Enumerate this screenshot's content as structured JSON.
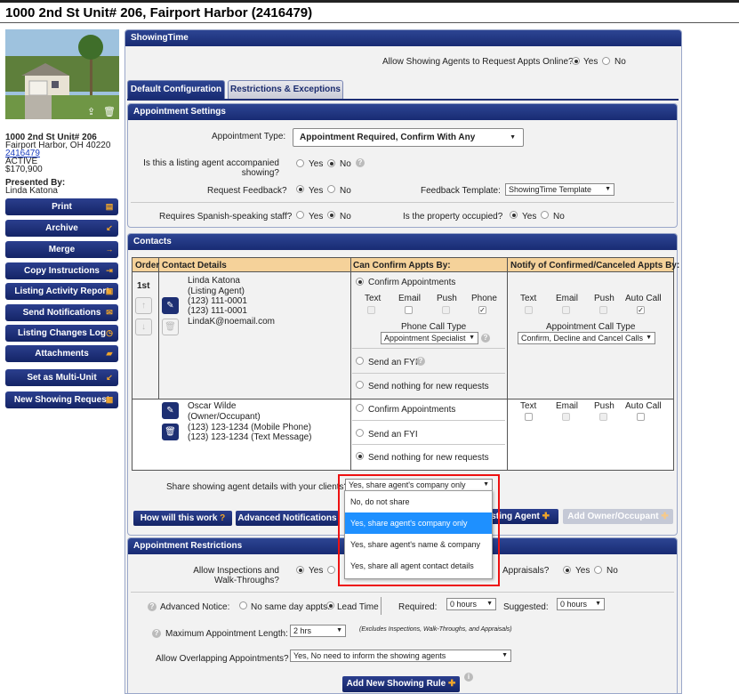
{
  "page_title": "1000 2nd St Unit# 206, Fairport Harbor (2416479)",
  "listing": {
    "address": "1000 2nd St Unit# 206",
    "city": "Fairport Harbor, OH 40220",
    "mls": "2416479",
    "status": "ACTIVE",
    "price": "$170,900",
    "presented_label": "Presented By:",
    "agent": "Linda Katona"
  },
  "sidebar_buttons": [
    {
      "label": "Print",
      "icon": "print-icon"
    },
    {
      "label": "Archive",
      "icon": "archive-icon"
    },
    {
      "label": "Merge",
      "icon": "merge-icon"
    },
    {
      "label": "Copy Instructions",
      "icon": "copy-icon"
    },
    {
      "label": "Listing Activity Report",
      "icon": "report-icon"
    },
    {
      "label": "Send Notifications",
      "icon": "envelope-icon"
    },
    {
      "label": "Listing Changes Log",
      "icon": "clock-icon"
    },
    {
      "label": "Attachments",
      "icon": "folder-icon"
    },
    {
      "label": "Set as Multi-Unit",
      "icon": "multiunit-icon"
    },
    {
      "label": "New Showing Request",
      "icon": "calendar-icon"
    }
  ],
  "showingtime": {
    "header": "ShowingTime",
    "allow_label": "Allow Showing Agents to Request Appts Online?",
    "yes": "Yes",
    "no": "No"
  },
  "tabs": {
    "default": "Default Configuration",
    "restrictions": "Restrictions & Exceptions"
  },
  "appt_settings": {
    "header": "Appointment Settings",
    "type_label": "Appointment Type:",
    "type_value": "Appointment Required, Confirm With Any",
    "accompanied_label1": "Is this a listing agent accompanied",
    "accompanied_label2": "showing?",
    "feedback_label": "Request Feedback?",
    "feedback_template_label": "Feedback Template:",
    "feedback_template_value": "ShowingTime Template",
    "spanish_label": "Requires Spanish-speaking staff?",
    "occupied_label": "Is the property occupied?",
    "yes": "Yes",
    "no": "No"
  },
  "contacts": {
    "header": "Contacts",
    "col_order": "Order",
    "col_details": "Contact Details",
    "col_confirm": "Can Confirm Appts By:",
    "col_notify": "Notify of Confirmed/Canceled Appts By:",
    "order_1": "1st",
    "c1": {
      "name": "Linda Katona",
      "role": "(Listing Agent)",
      "phone1": "(123) 111-0001",
      "phone2": "(123) 111-0001",
      "email": "LindaK@noemail.com"
    },
    "c2": {
      "name": "Oscar Wilde",
      "role": "(Owner/Occupant)",
      "phone1": "(123) 123-1234 (Mobile Phone)",
      "phone2": "(123) 123-1234 (Text Message)"
    },
    "confirm_appts": "Confirm Appointments",
    "send_fyi": "Send an FYI",
    "send_nothing": "Send nothing for new requests",
    "m_text": "Text",
    "m_email": "Email",
    "m_push": "Push",
    "m_phone": "Phone",
    "m_autocall": "Auto Call",
    "phone_call_type_label": "Phone Call Type",
    "phone_call_type_value": "Appointment Specialist",
    "auto_call_type_label": "Appointment Call Type",
    "auto_call_type_value": "Confirm, Decline and Cancel Calls"
  },
  "share": {
    "label": "Share showing agent details with your clients?:",
    "selected": "Yes, share agent's company only",
    "options": [
      "No, do not share",
      "Yes, share agent's company only",
      "Yes, share agent's name & company",
      "Yes, share all agent contact details"
    ]
  },
  "buttons": {
    "how": "How will this work",
    "advanced": "Advanced Notifications",
    "listing_agent": "Listing Agent",
    "add_owner": "Add Owner/Occupant"
  },
  "restrictions": {
    "header": "Appointment Restrictions",
    "inspections_label1": "Allow Inspections and",
    "inspections_label2": "Walk-Throughs?",
    "appraisals_label": "Appraisals?",
    "yes": "Yes",
    "no": "No",
    "advanced_notice_label": "Advanced Notice:",
    "no_same_day": "No same day appts.",
    "lead_time": "Lead Time",
    "required_label": "Required:",
    "required_value": "0 hours",
    "suggested_label": "Suggested:",
    "suggested_value": "0 hours",
    "max_len_label": "Maximum Appointment Length:",
    "max_len_value": "2 hrs",
    "max_len_note": "(Excludes Inspections, Walk-Throughs, and Appraisals)",
    "overlap_label": "Allow Overlapping Appointments?",
    "overlap_value": "Yes, No need to inform the showing agents",
    "add_rule": "Add New Showing Rule"
  }
}
